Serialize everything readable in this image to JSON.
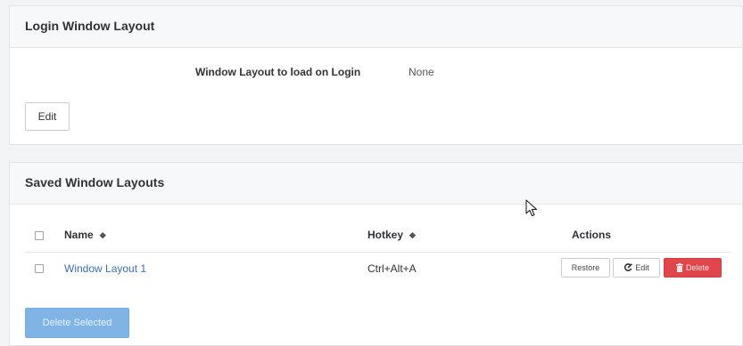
{
  "login_panel": {
    "title": "Login Window Layout",
    "setting_label": "Window Layout to load on Login",
    "setting_value": "None",
    "edit_button": "Edit"
  },
  "saved_panel": {
    "title": "Saved Window Layouts",
    "columns": {
      "name": "Name",
      "hotkey": "Hotkey",
      "actions": "Actions"
    },
    "sort_icon": "sort-icon",
    "rows": [
      {
        "name": "Window Layout 1",
        "hotkey": "Ctrl+Alt+A",
        "actions": {
          "restore": "Restore",
          "edit": "Edit",
          "delete": "Delete"
        }
      }
    ],
    "delete_selected_button": "Delete Selected"
  },
  "colors": {
    "link": "#3a6fb0",
    "delete": "#e0474c",
    "primary_disabled": "#7fb4e4"
  }
}
